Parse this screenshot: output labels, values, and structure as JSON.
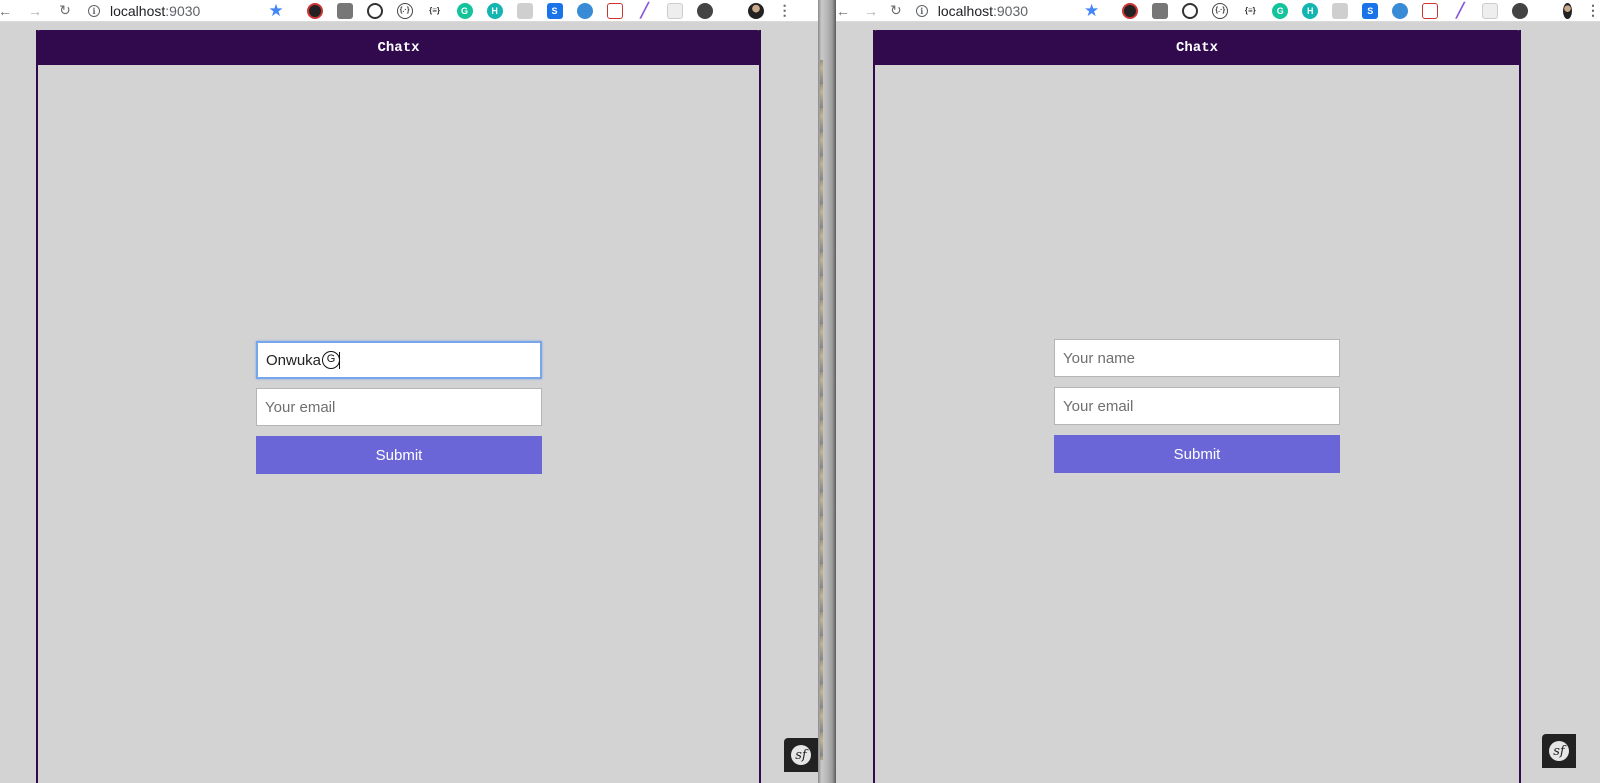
{
  "browser": {
    "url_host": "localhost",
    "url_port": ":9030",
    "back_icon": "arrow-left-icon",
    "forward_icon": "arrow-right-icon",
    "reload_icon": "reload-icon",
    "info_glyph": "i",
    "extension_glyphs": [
      "",
      "",
      "",
      "{.·}",
      "{≡}",
      "G",
      "H",
      "",
      "S",
      "",
      "",
      "",
      "",
      "",
      ""
    ]
  },
  "app": {
    "title": "Chatx",
    "header_color": "#300a4d",
    "button_color": "#6a66d8"
  },
  "left_window": {
    "name_value": "Onwuka",
    "email_placeholder": "Your email",
    "submit_label": "Submit",
    "cursor_glyph": "G"
  },
  "right_window": {
    "name_placeholder": "Your name",
    "email_placeholder": "Your email",
    "submit_label": "Submit"
  },
  "badge_glyph": "sf"
}
